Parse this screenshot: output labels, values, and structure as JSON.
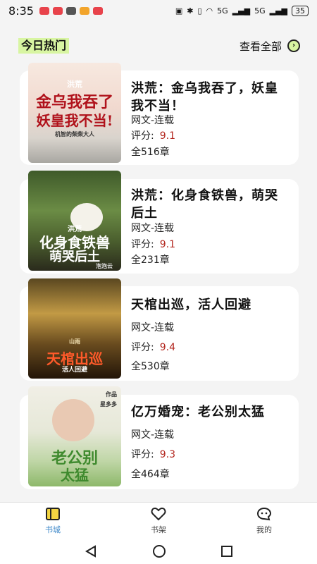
{
  "status": {
    "time": "8:35",
    "battery": "35",
    "network_labels": [
      "5G",
      "5G"
    ]
  },
  "section": {
    "title": "今日热门",
    "view_all": "查看全部"
  },
  "books": [
    {
      "title": "洪荒：金乌我吞了，妖皇我不当！",
      "category": "网文-连载",
      "score_label": "评分:",
      "score": "9.1",
      "chapters": "全516章",
      "cover": {
        "badge": "洪荒",
        "line1": "金乌我吞了",
        "line2": "妖皇我不当!",
        "author": "机智的柴柴大人"
      }
    },
    {
      "title": "洪荒：化身食铁兽，萌哭后土",
      "category": "网文-连载",
      "score_label": "评分:",
      "score": "9.1",
      "chapters": "全231章",
      "cover": {
        "badge": "洪荒",
        "line1": "化身食铁兽",
        "line2": "萌哭后土",
        "author": "泡泡云"
      }
    },
    {
      "title": "天棺出巡，活人回避",
      "category": "网文-连载",
      "score_label": "评分:",
      "score": "9.4",
      "chapters": "全530章",
      "cover": {
        "badge": "山雨",
        "line1": "天棺出巡",
        "line2": "活人回避",
        "author": "山雨"
      }
    },
    {
      "title": "亿万婚宠：老公别太猛",
      "category": "网文-连载",
      "score_label": "评分:",
      "score": "9.3",
      "chapters": "全464章",
      "cover": {
        "badge": "作品",
        "line1": "老公别",
        "line2": "太猛",
        "author": "星多多"
      }
    }
  ],
  "tabs": [
    {
      "label": "书城",
      "icon": "book-icon",
      "active": true
    },
    {
      "label": "书架",
      "icon": "heart-icon",
      "active": false
    },
    {
      "label": "我的",
      "icon": "chat-smile-icon",
      "active": false
    }
  ],
  "colors": {
    "accent": "#3a86c8",
    "highlight": "#d8f5a2",
    "score": "#b3261e"
  }
}
